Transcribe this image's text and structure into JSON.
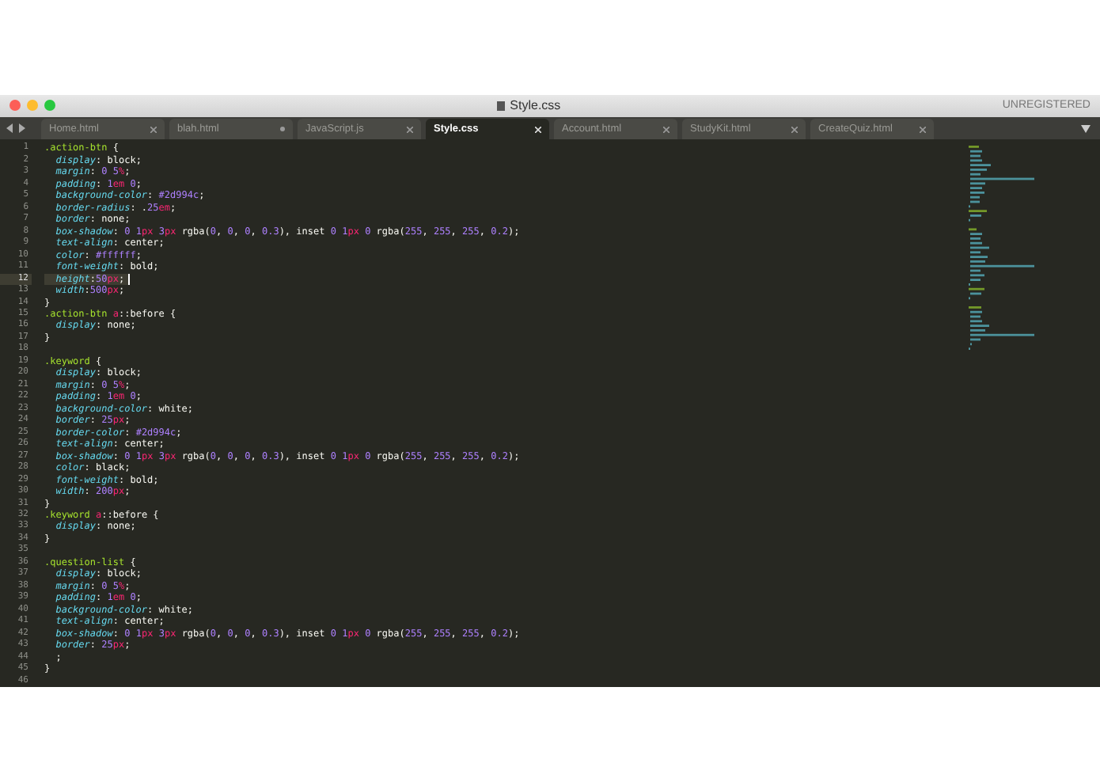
{
  "window": {
    "title": "Style.css",
    "status": "UNREGISTERED"
  },
  "tabs": [
    {
      "label": "Home.html",
      "selected": false,
      "modified": false
    },
    {
      "label": "blah.html",
      "selected": false,
      "modified": true
    },
    {
      "label": "JavaScript.js",
      "selected": false,
      "modified": false
    },
    {
      "label": "Style.css",
      "selected": true,
      "modified": false
    },
    {
      "label": "Account.html",
      "selected": false,
      "modified": false
    },
    {
      "label": "StudyKit.html",
      "selected": false,
      "modified": false
    },
    {
      "label": "CreateQuiz.html",
      "selected": false,
      "modified": false
    }
  ],
  "editor": {
    "lines": [
      {
        "number": "1",
        "text": ".action-btn {",
        "current": false
      },
      {
        "number": "2",
        "text": "  display: block;",
        "current": false
      },
      {
        "number": "3",
        "text": "  margin: 0 5%;",
        "current": false
      },
      {
        "number": "4",
        "text": "  padding: 1em 0;",
        "current": false
      },
      {
        "number": "5",
        "text": "  background-color: #2d994c;",
        "current": false
      },
      {
        "number": "6",
        "text": "  border-radius: .25em;",
        "current": false
      },
      {
        "number": "7",
        "text": "  border: none;",
        "current": false
      },
      {
        "number": "8",
        "text": "  box-shadow: 0 1px 3px rgba(0, 0, 0, 0.3), inset 0 1px 0 rgba(255, 255, 255, 0.2);",
        "current": false
      },
      {
        "number": "9",
        "text": "  text-align: center;",
        "current": false
      },
      {
        "number": "10",
        "text": "  color: #ffffff;",
        "current": false
      },
      {
        "number": "11",
        "text": "  font-weight: bold;",
        "current": false
      },
      {
        "number": "12",
        "text": "  height:50px;",
        "current": true
      },
      {
        "number": "13",
        "text": "  width:500px;",
        "current": false
      },
      {
        "number": "14",
        "text": "}",
        "current": false
      },
      {
        "number": "15",
        "text": ".action-btn a::before {",
        "current": false
      },
      {
        "number": "16",
        "text": "  display: none;",
        "current": false
      },
      {
        "number": "17",
        "text": "}",
        "current": false
      },
      {
        "number": "18",
        "current": false
      },
      {
        "number": "19",
        "text": ".keyword {",
        "current": false
      },
      {
        "number": "20",
        "text": "  display: block;",
        "current": false
      },
      {
        "number": "21",
        "text": "  margin: 0 5%;",
        "current": false
      },
      {
        "number": "22",
        "text": "  padding: 1em 0;",
        "current": false
      },
      {
        "number": "23",
        "text": "  background-color: white;",
        "current": false
      },
      {
        "number": "24",
        "text": "  border: 25px;",
        "current": false
      },
      {
        "number": "25",
        "text": "  border-color: #2d994c;",
        "current": false
      },
      {
        "number": "26",
        "text": "  text-align: center;",
        "current": false
      },
      {
        "number": "27",
        "text": "  box-shadow: 0 1px 3px rgba(0, 0, 0, 0.3), inset 0 1px 0 rgba(255, 255, 255, 0.2);",
        "current": false
      },
      {
        "number": "28",
        "text": "  color: black;",
        "current": false
      },
      {
        "number": "29",
        "text": "  font-weight: bold;",
        "current": false
      },
      {
        "number": "30",
        "text": "  width: 200px;",
        "current": false
      },
      {
        "number": "31",
        "text": "}",
        "current": false
      },
      {
        "number": "32",
        "text": ".keyword a::before {",
        "current": false
      },
      {
        "number": "33",
        "text": "  display: none;",
        "current": false
      },
      {
        "number": "34",
        "text": "}",
        "current": false
      },
      {
        "number": "35",
        "current": false
      },
      {
        "number": "36",
        "text": ".question-list {",
        "current": false
      },
      {
        "number": "37",
        "text": "  display: block;",
        "current": false
      },
      {
        "number": "38",
        "text": "  margin: 0 5%;",
        "current": false
      },
      {
        "number": "39",
        "text": "  padding: 1em 0;",
        "current": false
      },
      {
        "number": "40",
        "text": "  background-color: white;",
        "current": false
      },
      {
        "number": "41",
        "text": "  text-align: center;",
        "current": false
      },
      {
        "number": "42",
        "text": "  box-shadow: 0 1px 3px rgba(0, 0, 0, 0.3), inset 0 1px 0 rgba(255, 255, 255, 0.2);",
        "current": false
      },
      {
        "number": "43",
        "text": "  border: 25px;",
        "current": false
      },
      {
        "number": "44",
        "text": "  ;",
        "current": false
      },
      {
        "number": "45",
        "text": "}",
        "current": false
      },
      {
        "number": "46",
        "current": false
      }
    ]
  }
}
